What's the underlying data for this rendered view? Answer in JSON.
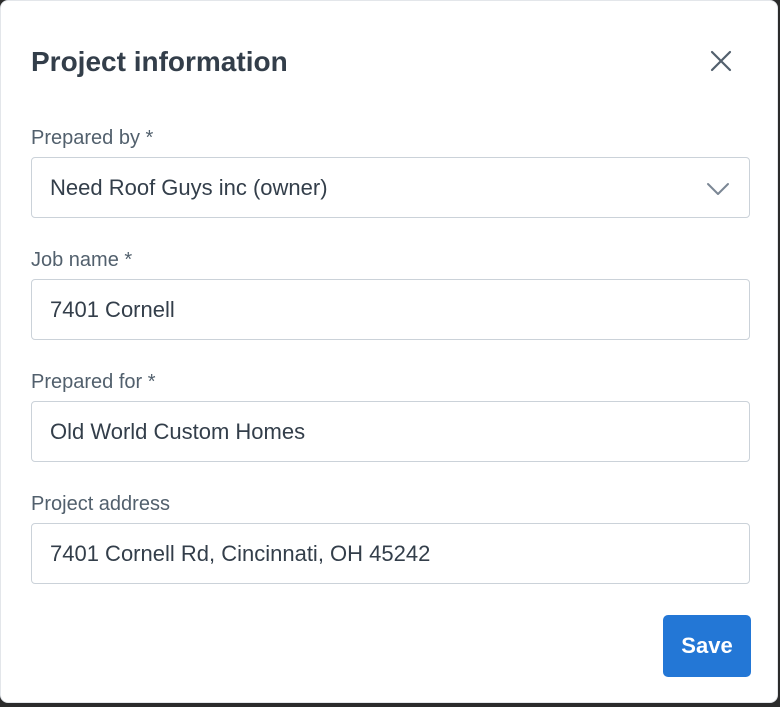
{
  "dialog": {
    "title": "Project information",
    "close_icon": "close-icon"
  },
  "fields": {
    "prepared_by": {
      "label": "Prepared by *",
      "value": "Need Roof Guys inc (owner)",
      "icon": "chevron-down-icon"
    },
    "job_name": {
      "label": "Job name *",
      "value": "7401 Cornell"
    },
    "prepared_for": {
      "label": "Prepared for *",
      "value": "Old World Custom Homes"
    },
    "project_address": {
      "label": "Project address",
      "value": "7401 Cornell Rd, Cincinnati, OH 45242"
    }
  },
  "actions": {
    "save_label": "Save"
  },
  "colors": {
    "primary": "#2377d6",
    "text": "#333e4a",
    "label": "#52606d",
    "border": "#cbd2d9"
  }
}
